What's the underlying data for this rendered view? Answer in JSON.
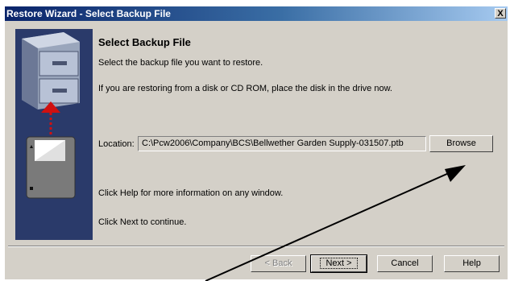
{
  "window": {
    "title": "Restore Wizard - Select Backup File",
    "close_label": "X"
  },
  "page": {
    "heading": "Select Backup File",
    "instruction1": "Select the backup file you want to restore.",
    "instruction2": "If you are restoring from a disk or CD ROM, place the disk in the drive now.",
    "help_text": "Click Help for more information on any window.",
    "next_text": "Click Next to continue."
  },
  "location": {
    "label": "Location:",
    "value": "C:\\Pcw2006\\Company\\BCS\\Bellwether Garden Supply-031507.ptb"
  },
  "buttons": {
    "browse": "Browse",
    "back": "< Back",
    "next": "Next >",
    "cancel": "Cancel",
    "help": "Help"
  },
  "colors": {
    "titlebar": "#0a246a",
    "panel": "#2a3a6a",
    "face": "#d4d0c8",
    "arrow_red": "#d01010"
  }
}
